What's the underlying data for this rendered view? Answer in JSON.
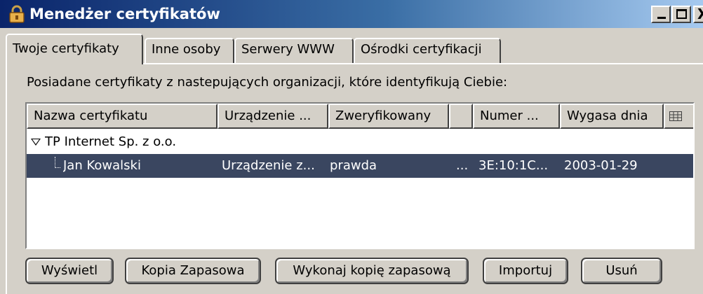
{
  "window": {
    "title": "Menedżer certyfikatów",
    "controls": {
      "minimize": "_",
      "maximize": "□",
      "close": "X"
    }
  },
  "tabs": [
    {
      "label": "Twoje certyfikaty",
      "active": true
    },
    {
      "label": "Inne osoby",
      "active": false
    },
    {
      "label": "Serwery WWW",
      "active": false
    },
    {
      "label": "Ośrodki certyfikacji",
      "active": false
    }
  ],
  "description": "Posiadane certyfikaty z nastepujących organizacji, które identyfikują Ciebie:",
  "table": {
    "columns": [
      "Nazwa certyfikatu",
      "Urządzenie ...",
      "Zweryfikowany",
      "",
      "Numer ...",
      "Wygasa dnia"
    ],
    "column_picker_icon": "column-picker-icon",
    "groups": [
      {
        "name": "TP Internet Sp. z o.o.",
        "expanded": true,
        "rows": [
          {
            "name": "Jan Kowalski",
            "device": "Urządzenie z...",
            "verified": "prawda",
            "extra": "...",
            "serial": "3E:10:1C...",
            "expires": "2003-01-29",
            "selected": true
          }
        ]
      }
    ]
  },
  "buttons": {
    "view": "Wyświetl",
    "backup": "Kopia Zapasowa",
    "backup_all": "Wykonaj kopię zapasową",
    "import": "Importuj",
    "delete": "Usuń"
  },
  "colors": {
    "titlebar_start": "#0a246a",
    "selection": "#3a4660",
    "face": "#d4d0c8"
  }
}
